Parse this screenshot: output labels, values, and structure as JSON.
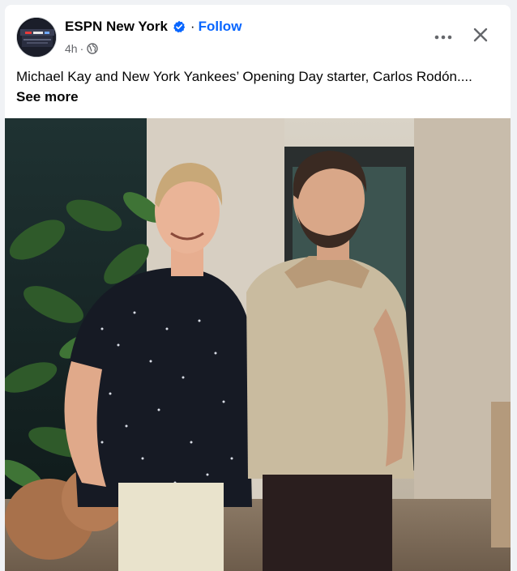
{
  "post": {
    "page_name": "ESPN New York",
    "separator": "·",
    "follow_label": "Follow",
    "time": "4h",
    "meta_separator": "·",
    "caption_text": "Michael Kay and New York Yankees’ Opening Day starter, Carlos Rodón....",
    "see_more_label": "See more",
    "verified_icon": "verified-badge-icon",
    "audience_icon": "globe-icon",
    "more_icon": "ellipsis-icon",
    "close_icon": "close-icon",
    "colors": {
      "accent": "#0866ff",
      "text_primary": "#050505",
      "text_secondary": "#65676b",
      "background": "#f0f2f5",
      "card": "#ffffff"
    }
  }
}
